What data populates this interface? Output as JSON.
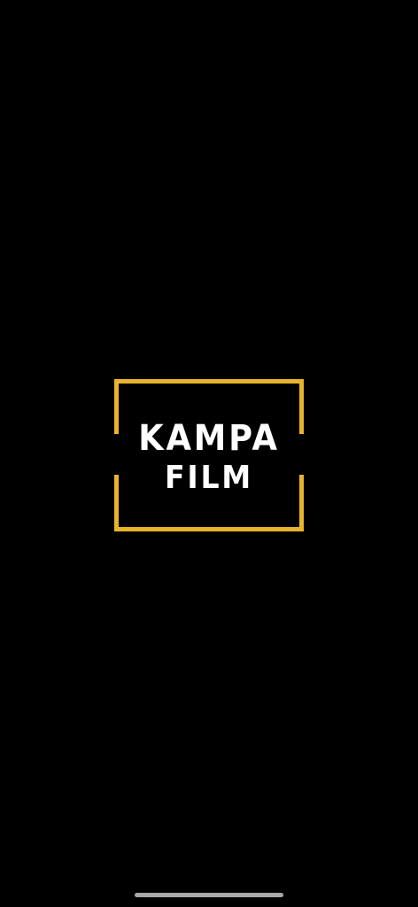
{
  "splash": {
    "logo": {
      "line1": "KAMPA",
      "line2": "FILM",
      "frame_color": "#E8B42C",
      "text_color": "#FFFFFF"
    },
    "background_color": "#000000"
  },
  "system": {
    "home_indicator": "home-indicator"
  }
}
